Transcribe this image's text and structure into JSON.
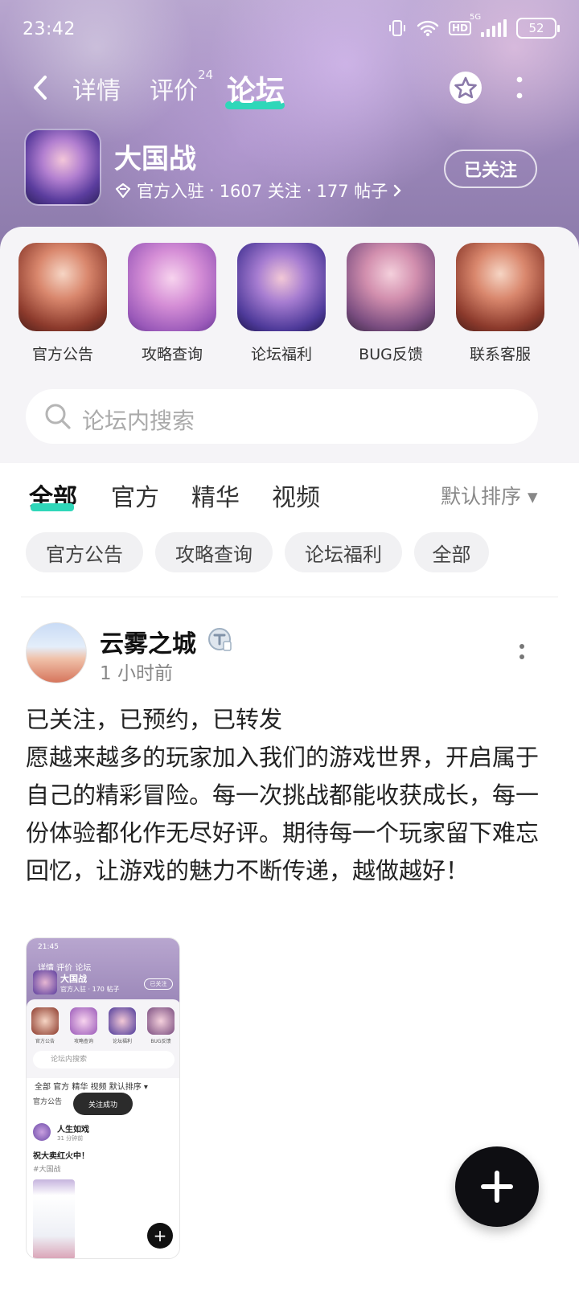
{
  "status_bar": {
    "time": "23:42",
    "battery": "52",
    "hd": "HD",
    "network": "5G"
  },
  "nav": {
    "tabs": [
      {
        "label": "详情"
      },
      {
        "label": "评价",
        "badge": "24"
      },
      {
        "label": "论坛"
      }
    ],
    "active_tab": "论坛"
  },
  "game": {
    "title": "大国战",
    "official": "官方入驻",
    "followers": "1607 关注",
    "posts": "177 帖子",
    "follow_button": "已关注"
  },
  "shortcuts": [
    {
      "label": "官方公告"
    },
    {
      "label": "攻略查询"
    },
    {
      "label": "论坛福利"
    },
    {
      "label": "BUG反馈"
    },
    {
      "label": "联系客服"
    }
  ],
  "search": {
    "placeholder": "论坛内搜索"
  },
  "filter_tabs": [
    {
      "label": "全部"
    },
    {
      "label": "官方"
    },
    {
      "label": "精华"
    },
    {
      "label": "视频"
    }
  ],
  "sort": {
    "label": "默认排序 ▾"
  },
  "chips": [
    {
      "label": "官方公告"
    },
    {
      "label": "攻略查询"
    },
    {
      "label": "论坛福利"
    },
    {
      "label": "全部"
    }
  ],
  "post": {
    "author": "云雾之城",
    "time": "1 小时前",
    "text": "已关注，已预约，已转发\n愿越来越多的玩家加入我们的游戏世界，开启属于自己的精彩冒险。每一次挑战都能收获成长，每一份体验都化作无尽好评。期待每一个玩家留下难忘回忆，让游戏的魅力不断传递，越做越好！"
  },
  "screenshot": {
    "time": "21:45",
    "tabs": "详情  评价  论坛",
    "title": "大国战",
    "meta": "官方入驻 · 170 帖子",
    "follow": "已关注",
    "shortcut_labels": [
      "官方公告",
      "攻略查询",
      "论坛福利",
      "BUG反馈"
    ],
    "search": "论坛内搜索",
    "filter": "全部  官方  精华  视频  默认排序 ▾",
    "chips": "官方公告",
    "chips_tail": "部",
    "toast": "关注成功",
    "user": "人生如戏",
    "user_time": "31 分钟前",
    "body": "祝大卖红火中！",
    "tag": "#大国战"
  },
  "colors": {
    "accent": "#2fd7b9",
    "header": "#9a86b8",
    "panel": "#f5f4f7"
  }
}
